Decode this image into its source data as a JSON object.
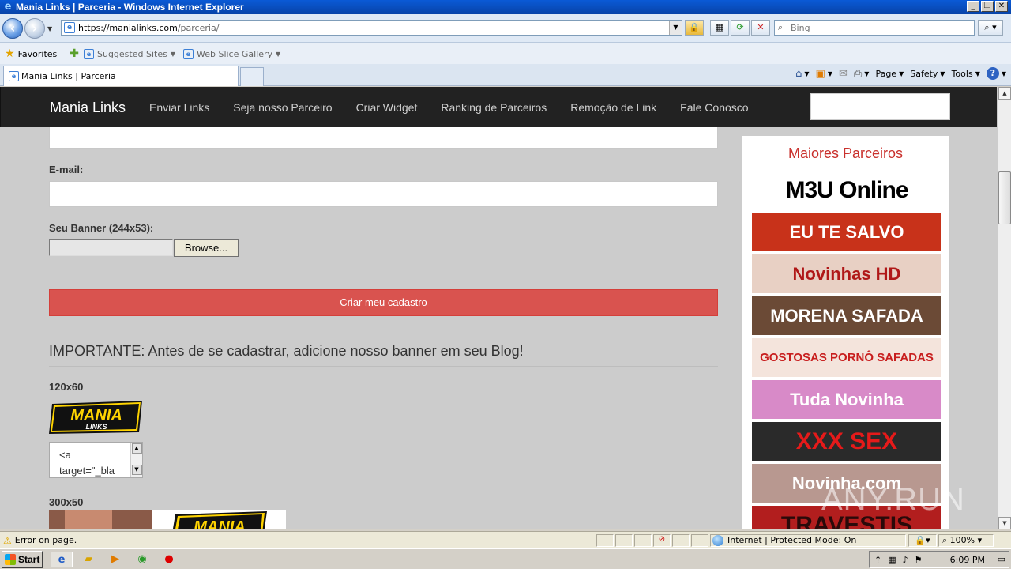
{
  "window": {
    "title": "Mania Links | Parceria - Windows Internet Explorer",
    "minimize": "_",
    "restore": "❐",
    "close": "✕"
  },
  "address": {
    "url_base": "https://manialinks.com",
    "url_path": "/parceria/",
    "search_placeholder": "Bing"
  },
  "favorites": {
    "favorites_label": "Favorites",
    "suggested_sites": "Suggested Sites",
    "web_slice_gallery": "Web Slice Gallery"
  },
  "tab": {
    "title": "Mania Links | Parceria"
  },
  "commands": {
    "page": "Page",
    "safety": "Safety",
    "tools": "Tools"
  },
  "site": {
    "brand": "Mania Links",
    "nav": [
      "Enviar Links",
      "Seja nosso Parceiro",
      "Criar Widget",
      "Ranking de Parceiros",
      "Remoção de Link",
      "Fale Conosco"
    ]
  },
  "form": {
    "email_label": "E-mail:",
    "banner_label": "Seu Banner (244x53):",
    "browse_button": "Browse...",
    "submit_button": "Criar meu cadastro",
    "important_text": "IMPORTANTE: Antes de se cadastrar, adicione nosso banner em seu Blog!",
    "size_120": "120x60",
    "size_300": "300x50",
    "code_snippet_line1": "<a",
    "code_snippet_line2": "target=\"_bla",
    "banner_logo_top": "MANIA",
    "banner_logo_bottom": "LINKS"
  },
  "sidebar": {
    "heading": "Maiores Parceiros",
    "partners": [
      {
        "text": "M3U Online",
        "bg": "#ffffff",
        "fg": "#000000"
      },
      {
        "text": "EU TE SALVO",
        "bg": "#c8321a",
        "fg": "#ffffff"
      },
      {
        "text": "Novinhas HD",
        "bg": "#e8d0c4",
        "fg": "#b01818"
      },
      {
        "text": "MORENA SAFADA",
        "bg": "#6b4a36",
        "fg": "#ffffff"
      },
      {
        "text": "GOSTOSAS PORNÔ SAFADAS",
        "bg": "#f4e4dc",
        "fg": "#c81e1e"
      },
      {
        "text": "Tuda Novinha",
        "bg": "#d88ac8",
        "fg": "#ffffff"
      },
      {
        "text": "XXX SEX",
        "bg": "#2a2a2a",
        "fg": "#e51a1a"
      },
      {
        "text": "Novinha.com",
        "bg": "#b89890",
        "fg": "#ffffff"
      },
      {
        "text": "TRAVESTIS",
        "bg": "#b21e1e",
        "fg": "#2a0a0a"
      }
    ]
  },
  "watermark": "ANY.RUN",
  "status": {
    "message": "Error on page.",
    "zone": "Internet | Protected Mode: On",
    "zoom": "100%"
  },
  "taskbar": {
    "start": "Start",
    "clock": "6:09 PM"
  },
  "colors": {
    "nav_bg": "#222222",
    "submit_bg": "#d9534f",
    "heading_red": "#c9302c",
    "page_bg": "#cccccc"
  }
}
